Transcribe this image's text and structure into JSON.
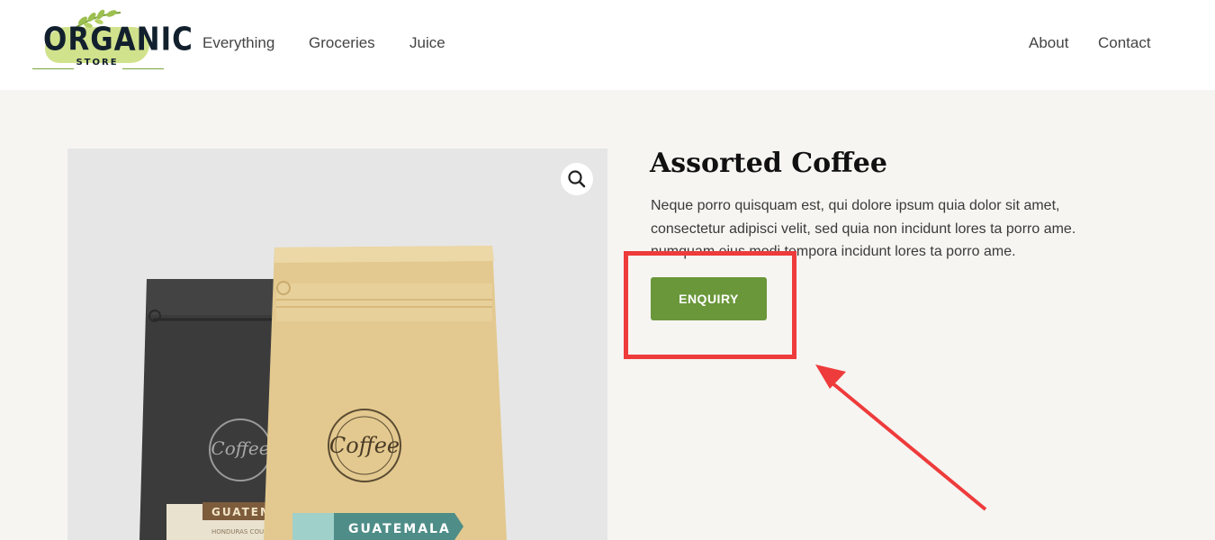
{
  "logo": {
    "main": "ORGANIC",
    "sub": "STORE"
  },
  "nav": {
    "left": [
      {
        "label": "Everything"
      },
      {
        "label": "Groceries"
      },
      {
        "label": "Juice"
      }
    ],
    "right": [
      {
        "label": "About"
      },
      {
        "label": "Contact"
      }
    ]
  },
  "product": {
    "title": "Assorted Coffee",
    "description": "Neque porro quisquam est, qui dolore ipsum quia dolor sit amet, consectetur adipisci velit, sed quia non incidunt lores ta porro ame. numquam eius modi tempora incidunt lores ta porro ame.",
    "cta_label": "ENQUIRY",
    "zoom_icon": "search-icon",
    "image": {
      "bag_back_brand": "Coffee",
      "bag_front_brand": "Coffee",
      "bag_back_label": "GUATEMA",
      "bag_back_sublabel": "HONDURAS COU",
      "bag_front_label": "GUATEMALA"
    }
  },
  "colors": {
    "accent_green": "#6a973a",
    "page_bg": "#f6f5f2",
    "annotation_red": "#ee3b3b"
  }
}
